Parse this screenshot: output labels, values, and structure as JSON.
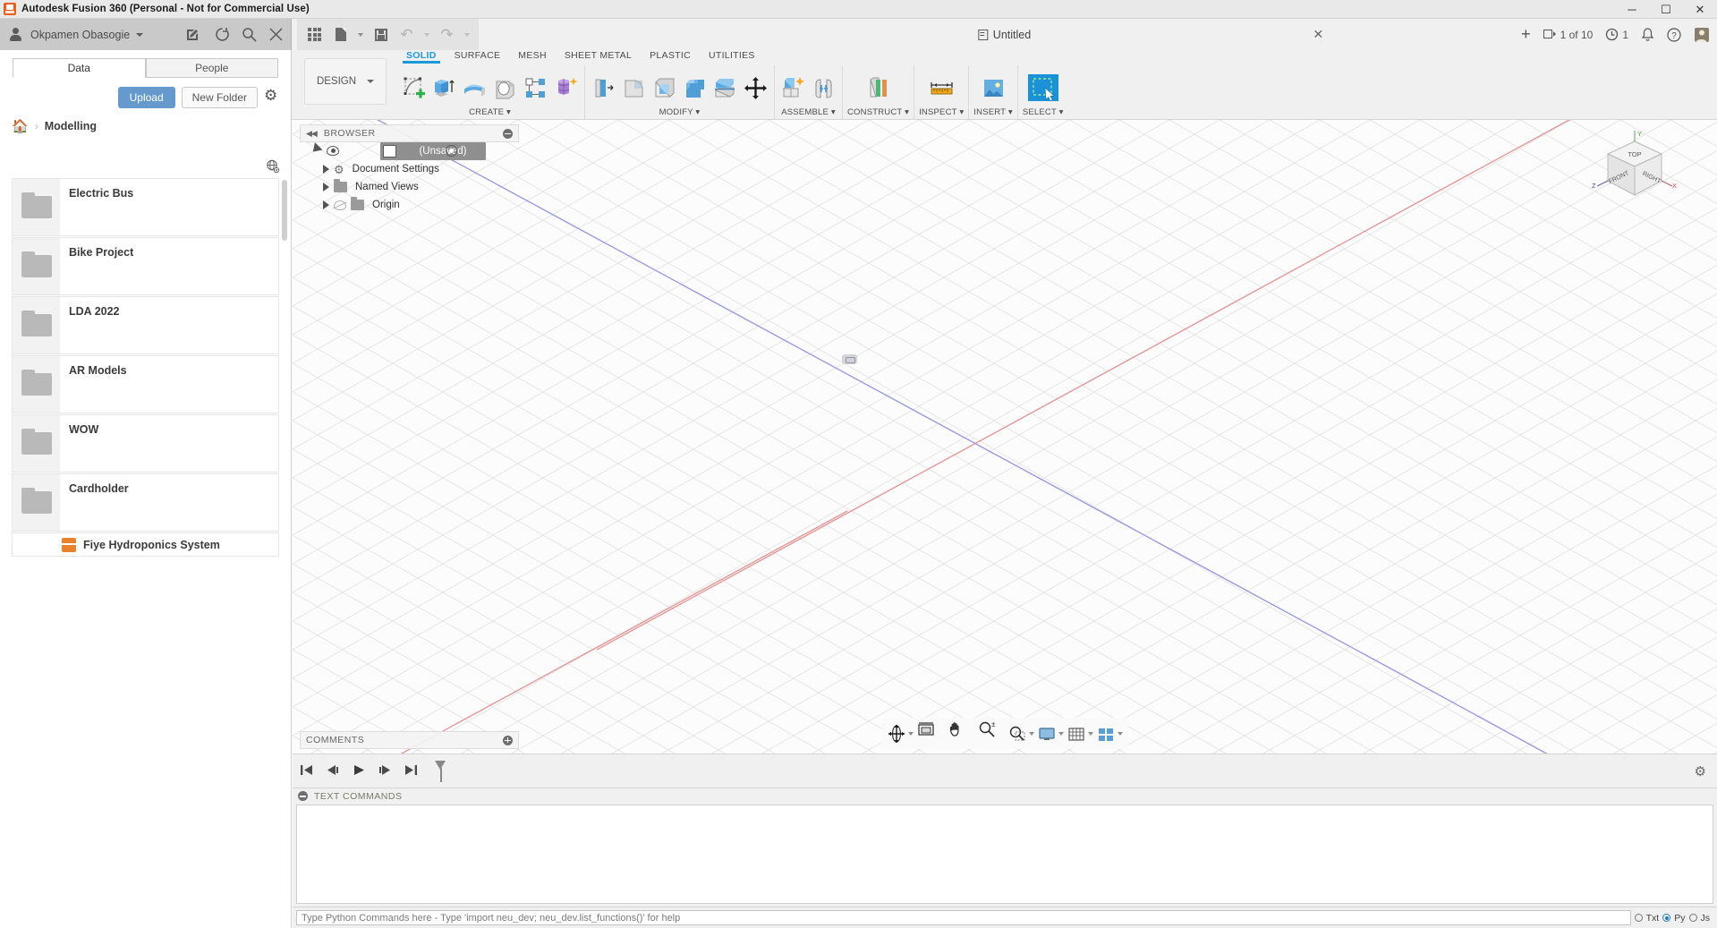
{
  "window": {
    "title": "Autodesk Fusion 360 (Personal - Not for Commercial Use)",
    "minimize": "─",
    "maximize": "☐",
    "close": "✕"
  },
  "account_bar": {
    "user_name": "Okpamen Obasogie",
    "icons": [
      "person-icon",
      "caret-down-icon",
      "edit-document-icon",
      "refresh-icon",
      "search-icon",
      "close-icon"
    ]
  },
  "quick_access": {
    "items": [
      "app-grid-icon",
      "new-document-icon",
      "save-icon",
      "undo-icon",
      "redo-icon"
    ],
    "doc_title": "Untitled",
    "close_tab": "✕",
    "new_tab": "+",
    "file_count": "1 of 10",
    "job_count": "1",
    "right_icons": [
      "clock-icon",
      "bell-icon",
      "help-icon",
      "avatar-icon"
    ]
  },
  "ribbon": {
    "design_label": "DESIGN",
    "tabs": [
      {
        "label": "SOLID",
        "active": true
      },
      {
        "label": "SURFACE",
        "active": false
      },
      {
        "label": "MESH",
        "active": false
      },
      {
        "label": "SHEET METAL",
        "active": false
      },
      {
        "label": "PLASTIC",
        "active": false
      },
      {
        "label": "UTILITIES",
        "active": false
      }
    ],
    "panels": [
      {
        "label": "CREATE ▾",
        "tools": [
          "create-sketch-icon",
          "extrude-icon",
          "revolve-icon",
          "sweep-icon",
          "pattern-icon",
          "form-icon"
        ]
      },
      {
        "label": "MODIFY ▾",
        "tools": [
          "press-pull-icon",
          "fillet-icon",
          "shell-icon",
          "combine-icon",
          "split-face-icon",
          "move-copy-icon"
        ]
      },
      {
        "label": "ASSEMBLE ▾",
        "tools": [
          "new-component-icon",
          "joint-icon"
        ]
      },
      {
        "label": "CONSTRUCT ▾",
        "tools": [
          "offset-plane-icon"
        ]
      },
      {
        "label": "INSPECT ▾",
        "tools": [
          "measure-icon"
        ]
      },
      {
        "label": "INSERT ▾",
        "tools": [
          "insert-image-icon"
        ]
      },
      {
        "label": "SELECT ▾",
        "tools": [
          "select-window-icon"
        ]
      }
    ]
  },
  "data_panel": {
    "tabs": [
      {
        "label": "Data",
        "active": true
      },
      {
        "label": "People",
        "active": false
      }
    ],
    "upload_label": "Upload",
    "new_folder_label": "New Folder",
    "settings_icon": "gear-icon",
    "globe_icon": "globe-icon",
    "breadcrumb": {
      "home_icon": "home-icon",
      "separator": "›",
      "current": "Modelling"
    },
    "files": [
      {
        "name": "Electric Bus",
        "type": "folder"
      },
      {
        "name": "Bike Project",
        "type": "folder"
      },
      {
        "name": "LDA 2022",
        "type": "folder"
      },
      {
        "name": "AR Models",
        "type": "folder"
      },
      {
        "name": "WOW",
        "type": "folder"
      },
      {
        "name": "Cardholder",
        "type": "folder"
      },
      {
        "name": "Fiye Hydroponics System",
        "type": "design"
      }
    ]
  },
  "browser": {
    "title": "BROWSER",
    "collapse_icon": "collapse-left-icon",
    "minimize_icon": "minus-circle-icon",
    "nodes": [
      {
        "label": "(Unsaved)",
        "selected": true,
        "depth": 0
      },
      {
        "label": "Document Settings",
        "selected": false,
        "depth": 1
      },
      {
        "label": "Named Views",
        "selected": false,
        "depth": 1
      },
      {
        "label": "Origin",
        "selected": false,
        "depth": 1,
        "hidden": true
      }
    ]
  },
  "viewcube": {
    "top": "TOP",
    "front": "FRONT",
    "right": "RIGHT",
    "axis_x": "X",
    "axis_y": "Y",
    "axis_z": "Z"
  },
  "comments": {
    "title": "COMMENTS",
    "add_icon": "plus-circle-icon"
  },
  "nav_toolbar": {
    "items": [
      "orbit-icon",
      "look-at-icon",
      "pan-icon",
      "zoom-icon",
      "zoom-window-icon",
      "display-settings-icon",
      "grid-snaps-icon",
      "viewports-icon"
    ]
  },
  "timeline": {
    "buttons": [
      "go-to-beginning-icon",
      "step-back-icon",
      "play-icon",
      "step-forward-icon",
      "go-to-end-icon"
    ],
    "marker": "timeline-marker-icon",
    "settings_icon": "gear-icon"
  },
  "text_commands": {
    "title": "TEXT COMMANDS",
    "minimize_icon": "minus-circle-icon",
    "input_placeholder": "Type Python Commands here - Type 'import neu_dev; neu_dev.list_functions()' for help",
    "input_value": "",
    "modes": [
      {
        "label": "Txt",
        "selected": false
      },
      {
        "label": "Py",
        "selected": true
      },
      {
        "label": "Js",
        "selected": false
      }
    ]
  },
  "colors": {
    "accent_blue": "#1b9ad6",
    "upload_blue": "#6699cc",
    "select_blue": "#1b92d7",
    "title_bar": "#e9e9e9",
    "account_bar": "#c9c9c9",
    "ribbon_bg": "#f0f0f0",
    "axis_red": "#e08d8d",
    "axis_blue": "#8c8ce0"
  }
}
